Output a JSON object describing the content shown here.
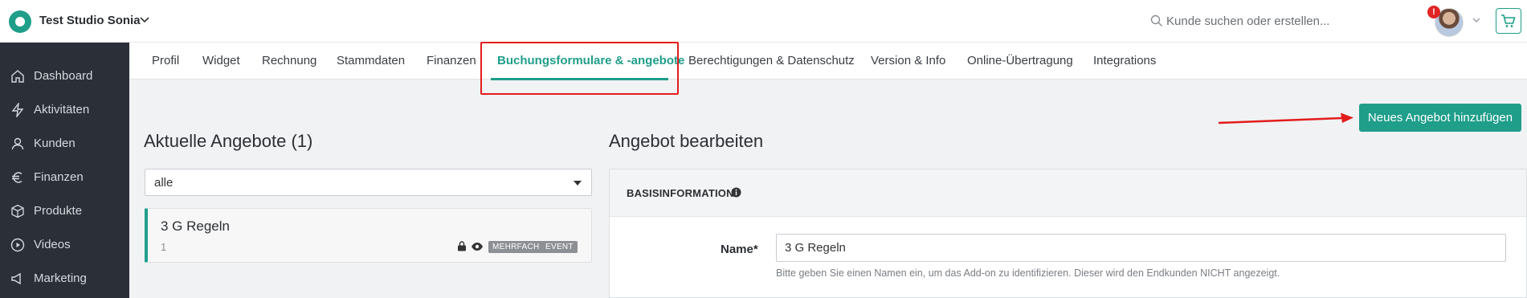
{
  "header": {
    "studio_name": "Test Studio Sonia",
    "search_placeholder": "Kunde suchen oder erstellen...",
    "notification_count": "!",
    "icons": {
      "logo": "brand-logo",
      "chevron": "chevron-down-icon",
      "search": "search-icon",
      "cart": "cart-icon"
    }
  },
  "sidebar": {
    "items": [
      {
        "label": "Dashboard",
        "icon": "home-icon"
      },
      {
        "label": "Aktivitäten",
        "icon": "bolt-icon"
      },
      {
        "label": "Kunden",
        "icon": "user-icon"
      },
      {
        "label": "Finanzen",
        "icon": "euro-icon"
      },
      {
        "label": "Produkte",
        "icon": "box-icon"
      },
      {
        "label": "Videos",
        "icon": "play-icon"
      },
      {
        "label": "Marketing",
        "icon": "megaphone-icon"
      }
    ]
  },
  "tabs": [
    {
      "label": "Profil",
      "active": false
    },
    {
      "label": "Widget",
      "active": false
    },
    {
      "label": "Rechnung",
      "active": false
    },
    {
      "label": "Stammdaten",
      "active": false
    },
    {
      "label": "Finanzen",
      "active": false
    },
    {
      "label": "Buchungsformulare & -angebote",
      "active": true
    },
    {
      "label": "Berechtigungen & Datenschutz",
      "active": false
    },
    {
      "label": "Version & Info",
      "active": false
    },
    {
      "label": "Online-Übertragung",
      "active": false
    },
    {
      "label": "Integrations",
      "active": false
    }
  ],
  "actions": {
    "add_offer_label": "Neues Angebot hinzufügen"
  },
  "offers": {
    "title": "Aktuelle Angebote (1)",
    "filter_value": "alle",
    "items": [
      {
        "name": "3 G Regeln",
        "count": "1",
        "badges": [
          "MEHRFACH",
          "EVENT"
        ]
      }
    ]
  },
  "edit": {
    "title": "Angebot bearbeiten",
    "section_label": "BASISINFORMATION",
    "name_label": "Name*",
    "name_value": "3 G Regeln",
    "name_hint": "Bitte geben Sie einen Namen ein, um das Add-on zu identifizieren. Dieser wird den Endkunden NICHT angezeigt."
  },
  "colors": {
    "accent": "#1f9e8a",
    "sidebar": "#2a2f38",
    "annotation_red": "#e21c1c"
  }
}
